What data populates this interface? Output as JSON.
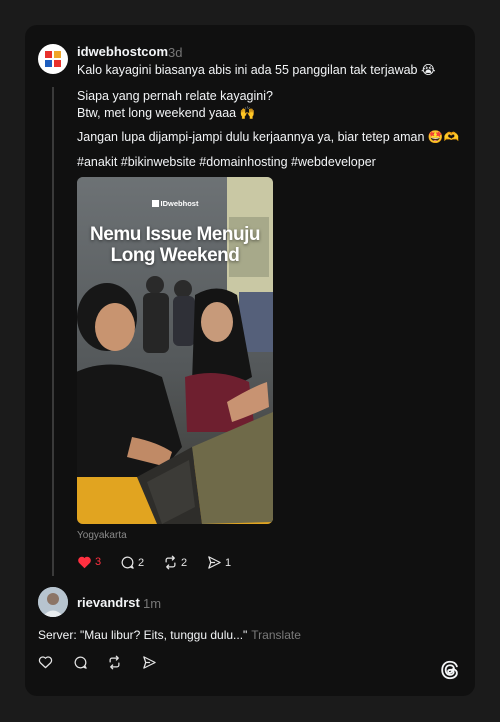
{
  "post": {
    "username": "idwebhostcom",
    "time": "3d",
    "lines": [
      "Kalo kayagini biasanya abis ini ada 55 panggilan tak terjawab 😭",
      "Siapa yang pernah relate kayagini?",
      "Btw, met long weekend yaaa 🙌",
      "Jangan lupa dijampi-jampi dulu kerjaannya ya, biar tetep aman 🤩🫶",
      "#anakit #bikinwebsite #domainhosting #webdeveloper"
    ],
    "image": {
      "brand": "IDwebhost",
      "headline_line1": "Nemu Issue Menuju",
      "headline_line2": "Long Weekend"
    },
    "location": "Yogyakarta",
    "actions": {
      "likes": "3",
      "replies": "2",
      "reposts": "2",
      "shares": "1"
    },
    "like_color": "#ff3040"
  },
  "reply": {
    "username": "rievandrst",
    "time": "1m",
    "text": "Server: \"Mau libur? Eits, tunggu dulu...\"",
    "translate_label": "Translate"
  }
}
